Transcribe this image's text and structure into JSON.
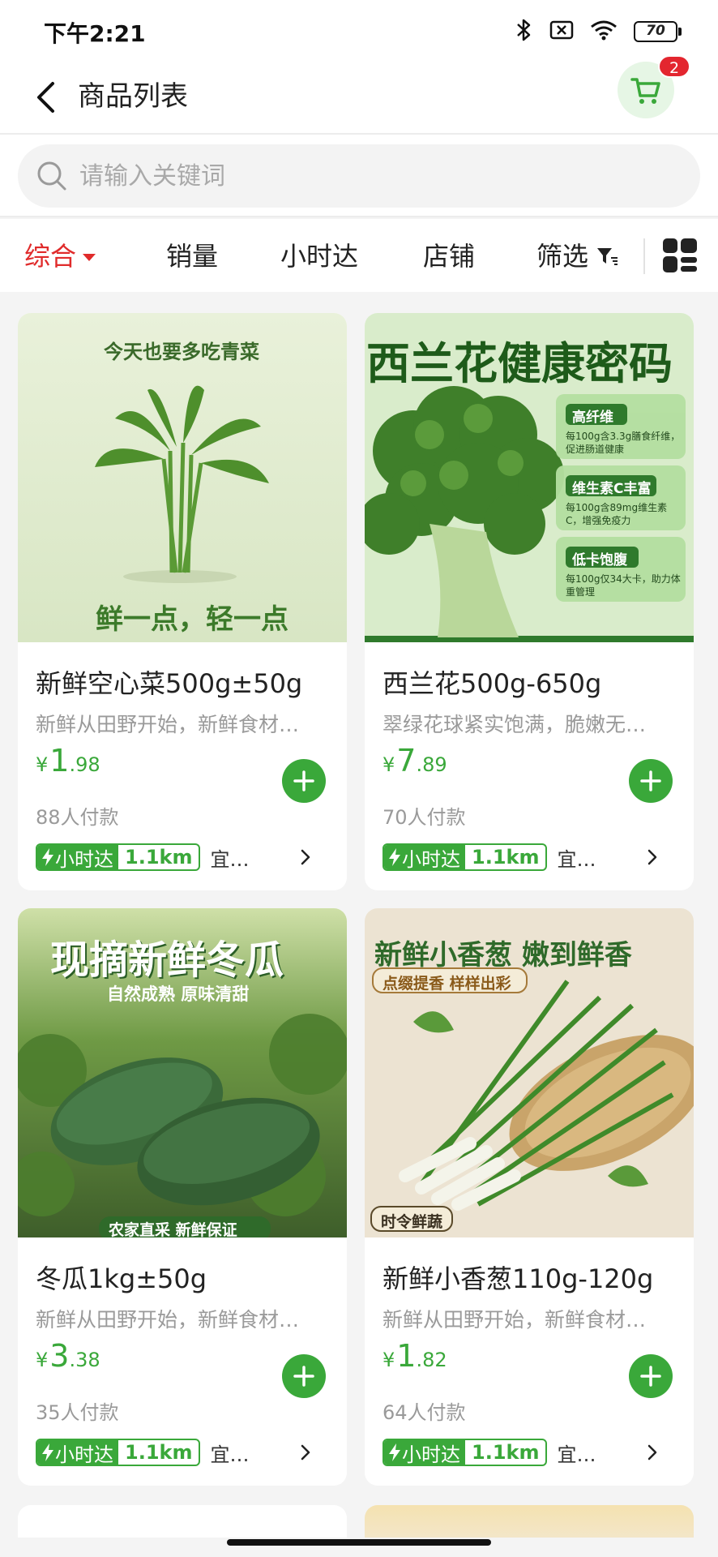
{
  "status_bar": {
    "time": "下午2:21",
    "battery": "70"
  },
  "header": {
    "title": "商品列表",
    "cart_count": "2"
  },
  "search": {
    "placeholder": "请输入关键词"
  },
  "tabs": {
    "comprehensive": "综合",
    "sales": "销量",
    "hourly": "小时达",
    "shop": "店铺",
    "filter": "筛选"
  },
  "colors": {
    "accent": "#3aa83a",
    "active_tab": "#e02b2b",
    "badge": "#e3262f"
  },
  "products": [
    {
      "image_caption_top": "今天也要多吃青菜",
      "image_caption_bottom": "鲜一点，轻一点",
      "title": "新鲜空心菜500g±50g",
      "desc": "新鲜从田野开始，新鲜食材…",
      "price_symbol": "¥",
      "price_int": "1",
      "price_dec": ".98",
      "sold": "88人付款",
      "delivery_label": "小时达",
      "distance": "1.1km",
      "store": "宜…"
    },
    {
      "image_caption_top": "西兰花健康密码",
      "image_tags": [
        "高纤维",
        "维生素C丰富",
        "低卡饱腹"
      ],
      "image_tag_desc": [
        "每100g含3.3g膳食纤维，促进肠道健康",
        "每100g含89mg维生素C，增强免疫力",
        "每100g仅34大卡，助力体重管理"
      ],
      "title": "西兰花500g-650g",
      "desc": "翠绿花球紧实饱满，脆嫩无…",
      "price_symbol": "¥",
      "price_int": "7",
      "price_dec": ".89",
      "sold": "70人付款",
      "delivery_label": "小时达",
      "distance": "1.1km",
      "store": "宜…"
    },
    {
      "image_caption_top": "现摘新鲜冬瓜",
      "image_caption_sub": "自然成熟 原味清甜",
      "image_caption_bottom": "农家直采 新鲜保证",
      "title": "冬瓜1kg±50g",
      "desc": "新鲜从田野开始，新鲜食材…",
      "price_symbol": "¥",
      "price_int": "3",
      "price_dec": ".38",
      "sold": "35人付款",
      "delivery_label": "小时达",
      "distance": "1.1km",
      "store": "宜…"
    },
    {
      "image_caption_top": "新鲜小香葱 嫩到鲜香",
      "image_caption_sub": "点缀提香 样样出彩",
      "image_caption_bottom": "时令鲜蔬",
      "title": "新鲜小香葱110g-120g",
      "desc": "新鲜从田野开始，新鲜食材…",
      "price_symbol": "¥",
      "price_int": "1",
      "price_dec": ".82",
      "sold": "64人付款",
      "delivery_label": "小时达",
      "distance": "1.1km",
      "store": "宜…"
    }
  ]
}
